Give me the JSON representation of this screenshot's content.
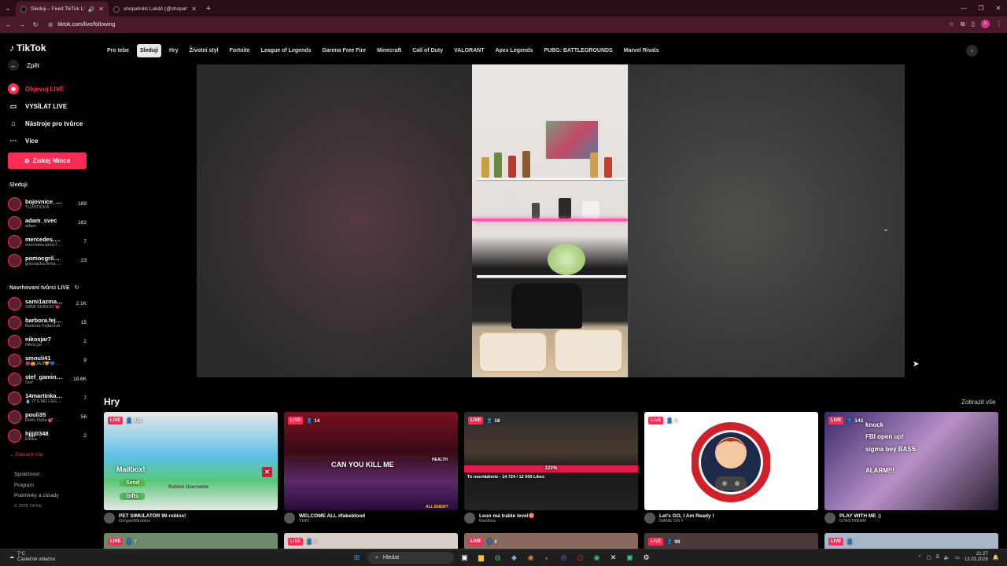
{
  "browser": {
    "tabs": [
      {
        "title": "Sleduji – Feed TikTok LIVE",
        "active": true
      },
      {
        "title": "shopaholic Lukáš (@shopaholi…",
        "active": false
      }
    ],
    "url": "tiktok.com/live/following",
    "profile_initial": "Y"
  },
  "sidebar": {
    "brand": "TikTok",
    "back_label": "Zpět",
    "menu": [
      {
        "label": "Objevuj LIVE",
        "icon": "live-discover-icon"
      },
      {
        "label": "VYSÍLAT LIVE",
        "icon": "video-camera-icon"
      },
      {
        "label": "Nástroje pro tvůrce",
        "icon": "home-icon"
      },
      {
        "label": "Více",
        "icon": "more-icon"
      }
    ],
    "coins_button": "Získej Mince",
    "following_title": "Sleduji",
    "following": [
      {
        "name": "bojovnice_…",
        "sub": "TLUSTIČKA",
        "count": "189"
      },
      {
        "name": "adam_svec",
        "sub": "adam",
        "count": "162"
      },
      {
        "name": "mercedes.…",
        "sub": "mercedes.benz7…",
        "count": "7"
      },
      {
        "name": "pomocgril…",
        "sub": "grilovačka firma …",
        "count": "23"
      }
    ],
    "suggested_title": "Navrhovaní tvůrci LIVE",
    "suggested": [
      {
        "name": "sami1azma…",
        "sub": "SAMI SHIKOR 💗",
        "count": "2.1K"
      },
      {
        "name": "barbora.fej…",
        "sub": "Barbora Fejfarová",
        "count": "15"
      },
      {
        "name": "nikosjar7",
        "sub": "Nikos.jar",
        "count": "2"
      },
      {
        "name": "smouli41",
        "sub": "🧶🍊JAJI🧡💙 …",
        "count": "9"
      },
      {
        "name": "stef_gamin…",
        "sub": "Stef",
        "count": "18.6K"
      },
      {
        "name": "14martinka…",
        "sub": "💧 IT'S ME LEG…",
        "count": "7"
      },
      {
        "name": "pouli35",
        "sub": "Retro Dáša 💕 …",
        "count": "56"
      },
      {
        "name": "hjjjj0348",
        "sub": "Eliška",
        "count": "2"
      }
    ],
    "show_more": "Zobrazit vše",
    "footer": [
      "Společnost",
      "Program",
      "Podmínky a zásady"
    ],
    "copyright": "© 2026 TikTok"
  },
  "categories": [
    "Pro tebe",
    "Sleduji",
    "Hry",
    "Životní styl",
    "Fortnite",
    "League of Legends",
    "Garena Free Fire",
    "Minecraft",
    "Call of Duty",
    "VALORANT",
    "Apex Legends",
    "PUBG: BATTLEGROUNDS",
    "Marvel Rivals"
  ],
  "selected_category": "Sleduji",
  "games": {
    "title": "Hry",
    "see_all": "Zobrazit vše",
    "live_label": "LIVE",
    "cards": [
      {
        "viewers": "116",
        "title": "PET SIMULATOR 99 roblox!",
        "sub": "Onlypet99roblox",
        "overlay": [
          "Mailbox!",
          "Send",
          "Gifts",
          "Roblox Username"
        ]
      },
      {
        "viewers": "14",
        "title": "WELCOME ALL #fakeblood",
        "sub": "YUKI",
        "overlay": [
          "CAN YOU KILL ME",
          "HEALTH",
          "ALL ENEMY"
        ]
      },
      {
        "viewers": "18",
        "title": "Leon má trable level🎯",
        "sub": "Manfista",
        "overlay": [
          "122%",
          "To nezvládnete - 14 724 / 12 000 Likes"
        ]
      },
      {
        "viewers": "3",
        "title": "Let's GO, I Am Ready !",
        "sub": "GAME ON !!",
        "overlay": []
      },
      {
        "viewers": "143",
        "title": "PLAY WITH ME :)",
        "sub": "GTASTREAM",
        "overlay": [
          "knock",
          "FBI open up!",
          "sigma boy BASS",
          "ALARM!!!"
        ]
      }
    ],
    "bottom_viewers": [
      "7",
      "0",
      "8",
      "98",
      "0"
    ]
  },
  "taskbar": {
    "weather_temp": "7°C",
    "weather_desc": "Částečně oblačno",
    "search_label": "Hledat",
    "time": "21:27",
    "date": "13.03.2026"
  }
}
